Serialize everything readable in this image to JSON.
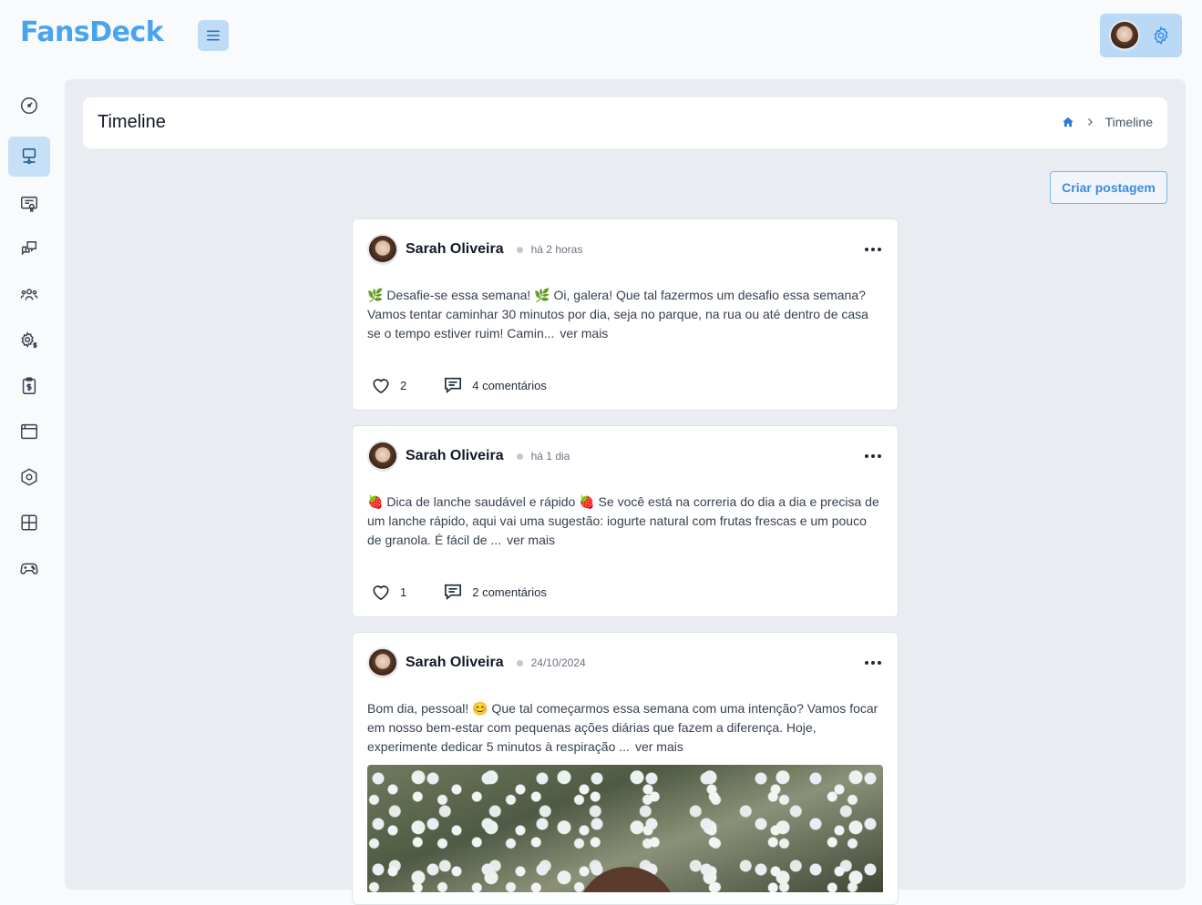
{
  "app": {
    "logo_text": "FansDeck",
    "accent": "#4aa3f0"
  },
  "topbar": {
    "menu_icon": "hamburger-icon",
    "user_avatar": "user-avatar",
    "settings_icon": "gear-icon"
  },
  "sidebar": {
    "items": [
      {
        "name": "dashboard",
        "icon": "gauge-icon",
        "active": false
      },
      {
        "name": "timeline",
        "icon": "monitor-user-icon",
        "active": true
      },
      {
        "name": "certificates",
        "icon": "certificate-icon",
        "active": false
      },
      {
        "name": "messages",
        "icon": "chat-icon",
        "active": false
      },
      {
        "name": "community",
        "icon": "users-icon",
        "active": false
      },
      {
        "name": "billing-settings",
        "icon": "gear-dollar-icon",
        "active": false
      },
      {
        "name": "finance",
        "icon": "clipboard-dollar-icon",
        "active": false
      },
      {
        "name": "browser",
        "icon": "window-icon",
        "active": false
      },
      {
        "name": "integrations",
        "icon": "hexagon-icon",
        "active": false
      },
      {
        "name": "apps",
        "icon": "grid-icon",
        "active": false
      },
      {
        "name": "games",
        "icon": "gamepad-icon",
        "active": false
      }
    ]
  },
  "page": {
    "title": "Timeline",
    "breadcrumb_current": "Timeline",
    "create_button": "Criar postagem"
  },
  "posts": [
    {
      "author": "Sarah Oliveira",
      "time": "há 2 horas",
      "text": "🌿 Desafie-se essa semana! 🌿 Oi, galera! Que tal fazermos um desafio essa semana? Vamos tentar caminhar 30 minutos por dia, seja no parque, na rua ou até dentro de casa se o tempo estiver ruim! Camin...",
      "see_more": "ver mais",
      "likes": "2",
      "comments": "4 comentários"
    },
    {
      "author": "Sarah Oliveira",
      "time": "há 1 dia",
      "text": "🍓 Dica de lanche saudável e rápido 🍓 Se você está na correria do dia a dia e precisa de um lanche rápido, aqui vai uma sugestão: iogurte natural com frutas frescas e um pouco de granola. É fácil de ...",
      "see_more": "ver mais",
      "likes": "1",
      "comments": "2 comentários"
    },
    {
      "author": "Sarah Oliveira",
      "time": "24/10/2024",
      "text": "Bom dia, pessoal! 😊 Que tal começarmos essa semana com uma intenção? Vamos focar em nosso bem-estar com pequenas ações diárias que fazem a diferença. Hoje, experimente dedicar 5 minutos à respiração ...",
      "see_more": "ver mais"
    }
  ]
}
